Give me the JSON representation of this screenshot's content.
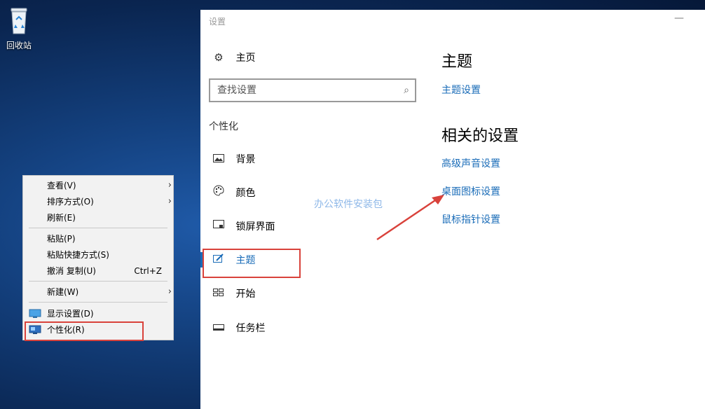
{
  "desktop": {
    "recycle_bin_label": "回收站"
  },
  "context_menu": {
    "items": [
      {
        "label": "查看(V)"
      },
      {
        "label": "排序方式(O)"
      },
      {
        "label": "刷新(E)"
      },
      {
        "label": "粘贴(P)"
      },
      {
        "label": "粘贴快捷方式(S)"
      },
      {
        "label": "撤消 复制(U)",
        "shortcut": "Ctrl+Z"
      },
      {
        "label": "新建(W)"
      },
      {
        "label": "显示设置(D)"
      },
      {
        "label": "个性化(R)"
      }
    ]
  },
  "settings": {
    "window_title": "设置",
    "minimize_glyph": "—",
    "home_label": "主页",
    "search_placeholder": "查找设置",
    "section_label": "个性化",
    "nav": [
      {
        "label": "背景",
        "icon": "image-icon"
      },
      {
        "label": "颜色",
        "icon": "palette-icon"
      },
      {
        "label": "锁屏界面",
        "icon": "lockscreen-icon"
      },
      {
        "label": "主题",
        "icon": "theme-icon",
        "active": true
      },
      {
        "label": "开始",
        "icon": "start-icon"
      },
      {
        "label": "任务栏",
        "icon": "taskbar-icon"
      }
    ],
    "content": {
      "heading": "主题",
      "theme_link": "主题设置",
      "related_heading": "相关的设置",
      "related_links": [
        "高级声音设置",
        "桌面图标设置",
        "鼠标指针设置"
      ]
    }
  },
  "watermark": "办公软件安装包",
  "colors": {
    "accent": "#1a6cb8",
    "highlight_box": "#d9423b"
  }
}
